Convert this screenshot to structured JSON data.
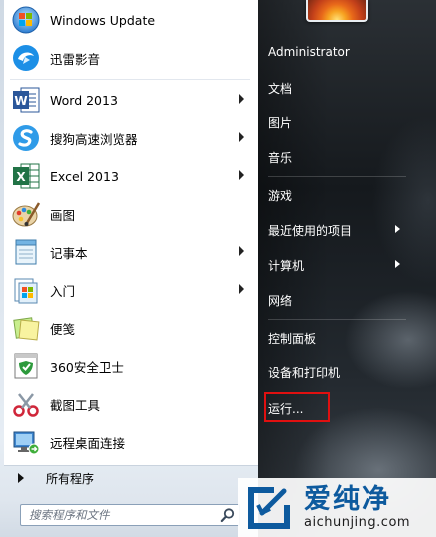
{
  "programs": [
    {
      "label": "Windows Update",
      "icon": "windows-update-icon",
      "submenu": false
    },
    {
      "label": "迅雷影音",
      "icon": "xunlei-player-icon",
      "submenu": false
    },
    {
      "label": "Word 2013",
      "icon": "word-icon",
      "submenu": true
    },
    {
      "label": "搜狗高速浏览器",
      "icon": "sogou-browser-icon",
      "submenu": true
    },
    {
      "label": "Excel 2013",
      "icon": "excel-icon",
      "submenu": true
    },
    {
      "label": "画图",
      "icon": "paint-icon",
      "submenu": false
    },
    {
      "label": "记事本",
      "icon": "notepad-icon",
      "submenu": true
    },
    {
      "label": "入门",
      "icon": "getting-started-icon",
      "submenu": true
    },
    {
      "label": "便笺",
      "icon": "sticky-notes-icon",
      "submenu": false
    },
    {
      "label": "360安全卫士",
      "icon": "360-safe-icon",
      "submenu": false
    },
    {
      "label": "截图工具",
      "icon": "snipping-tool-icon",
      "submenu": false
    },
    {
      "label": "远程桌面连接",
      "icon": "remote-desktop-icon",
      "submenu": false
    }
  ],
  "all_programs": "所有程序",
  "search": {
    "placeholder": "搜索程序和文件"
  },
  "right_items": [
    {
      "label": "Administrator",
      "submenu": false
    },
    {
      "label": "文档",
      "submenu": false
    },
    {
      "label": "图片",
      "submenu": false
    },
    {
      "label": "音乐",
      "submenu": false
    },
    {
      "label": "游戏",
      "submenu": false
    },
    {
      "label": "最近使用的项目",
      "submenu": true
    },
    {
      "label": "计算机",
      "submenu": true
    },
    {
      "label": "网络",
      "submenu": false
    },
    {
      "label": "控制面板",
      "submenu": false
    },
    {
      "label": "设备和打印机",
      "submenu": false
    },
    {
      "label": "运行...",
      "submenu": false
    }
  ],
  "highlighted_item": "运行...",
  "colors": {
    "highlight": "#e01010",
    "watermark_blue": "#0d5a9e"
  },
  "watermark": {
    "cn": "爱纯净",
    "en": "aichunjing.com"
  }
}
